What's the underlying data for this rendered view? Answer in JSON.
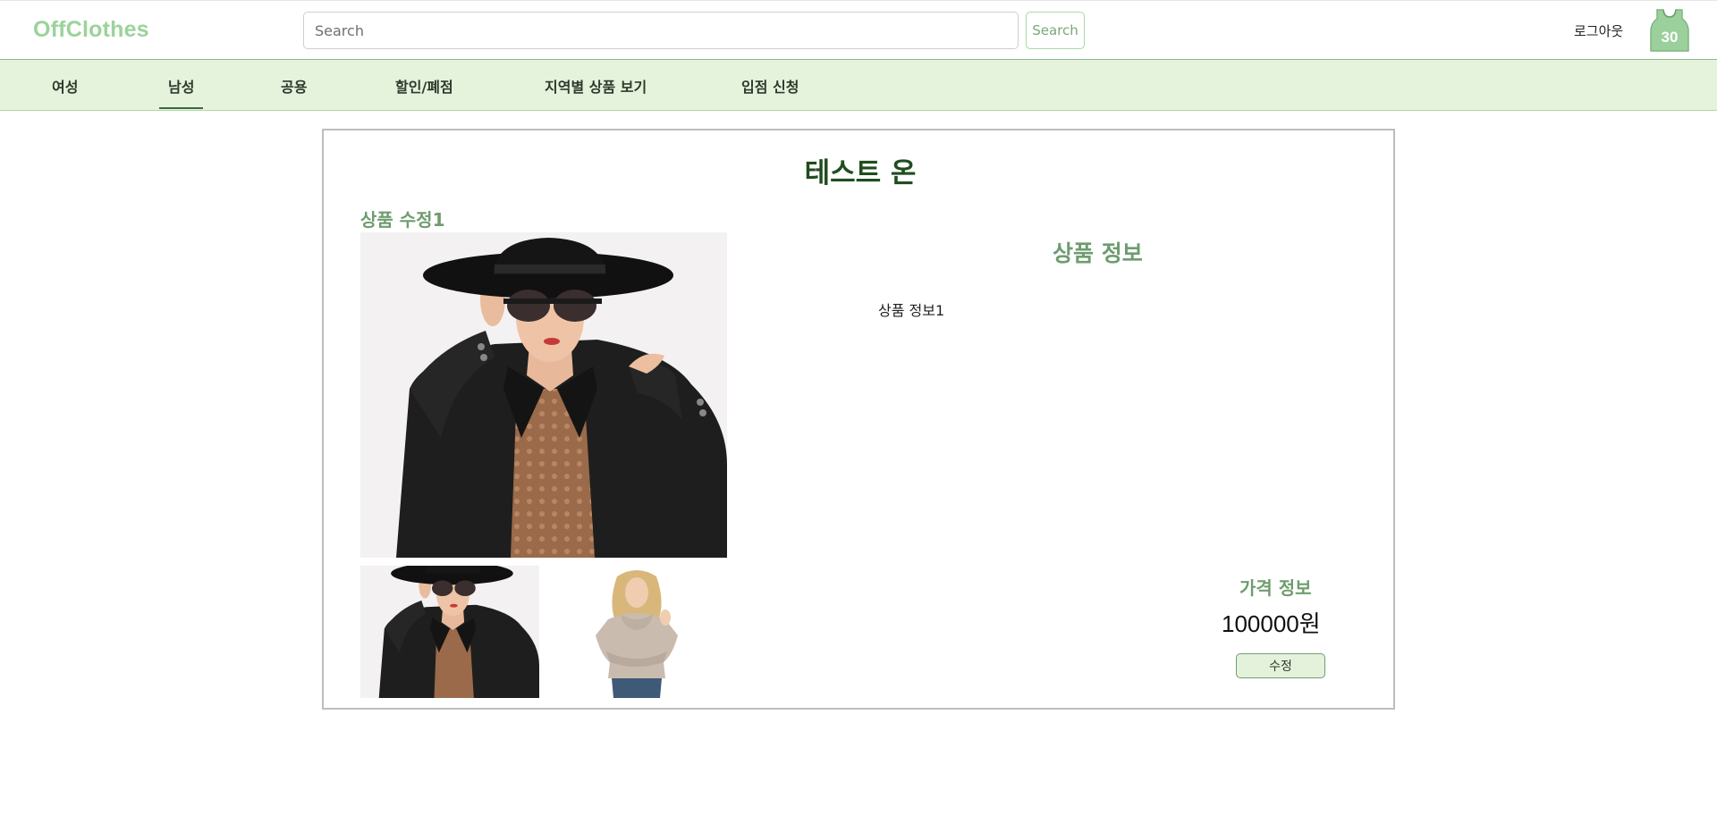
{
  "header": {
    "logo": "OffClothes",
    "search_placeholder": "Search",
    "search_button": "Search",
    "logout": "로그아웃",
    "avatar_icon": "jersey-30-icon",
    "avatar_number": "30"
  },
  "nav": {
    "items": [
      {
        "label": "여성",
        "active": false
      },
      {
        "label": "남성",
        "active": true
      },
      {
        "label": "공용",
        "active": false
      },
      {
        "label": "할인/폐점",
        "active": false
      },
      {
        "label": "지역별 상품 보기",
        "active": false
      },
      {
        "label": "입점 신청",
        "active": false
      }
    ]
  },
  "product": {
    "store_name": "테스트 온",
    "name": "상품 수정1",
    "info_title": "상품 정보",
    "info_text": "상품 정보1",
    "price_title": "가격 정보",
    "price": "100000원",
    "edit_button": "수정"
  },
  "colors": {
    "accent": "#9bd39b",
    "nav_bg": "#e6f3dc",
    "heading_green": "#6f9c6f",
    "title_green": "#1f4d1f"
  }
}
